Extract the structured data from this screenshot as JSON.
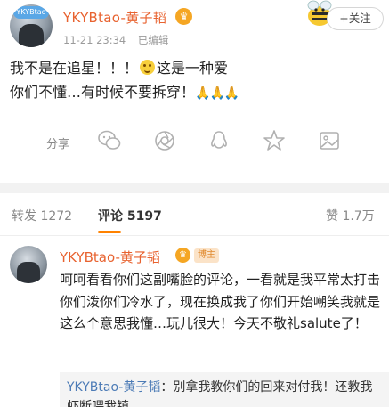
{
  "post": {
    "avatar_tag": "YKYBtao",
    "username": "YKYBtao-黄子韬",
    "date": "11-21 23:34",
    "edited": "已编辑",
    "follow_label": "+关注",
    "text_line1_a": "我不是在追星！！！",
    "text_line1_b": "这是一种爱",
    "text_line2": "你们不懂…有时候不要拆穿！",
    "hands_emoji": "🙏🙏🙏"
  },
  "share": {
    "label": "分享",
    "icons": [
      "wechat-icon",
      "moments-icon",
      "qq-icon",
      "qzone-icon",
      "image-icon"
    ],
    "accent": "#b0b0b0"
  },
  "tabs": {
    "repost_label": "转发",
    "repost_count": "1272",
    "comment_label": "评论",
    "comment_count": "5197",
    "like_label": "赞",
    "like_count": "1.7万",
    "accent": "#ff8200"
  },
  "comment": {
    "username": "YKYBtao-黄子韬",
    "badge": "博主",
    "text": "呵呵看看你们这副嘴脸的评论，一看就是我平常太打击你们泼你们冷水了，现在换成我了你们开始嘲笑我就是这么个意思我懂…玩儿很大！今天不敬礼salute了！",
    "reply_name": "YKYBtao-黄子韬",
    "reply_text": "：别拿我教你们的回来对付我！还教我虾断喂我镇"
  }
}
